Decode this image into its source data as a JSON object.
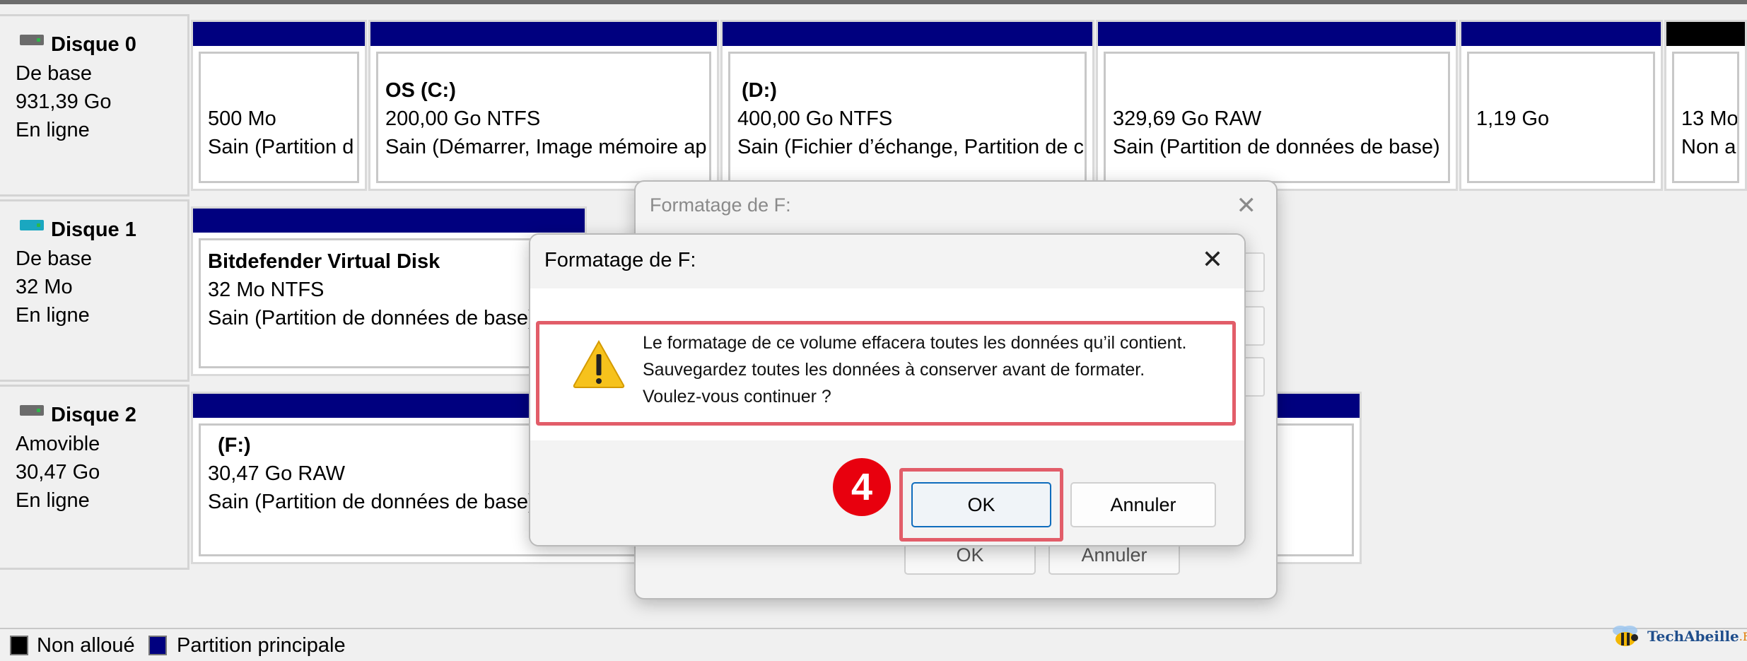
{
  "disks": [
    {
      "name": "Disque 0",
      "type": "De base",
      "size": "931,39 Go",
      "status": "En ligne",
      "icon": "hard-drive-icon",
      "partitions": [
        {
          "label": "",
          "size": "500 Mo",
          "status": "Sain (Partition d"
        },
        {
          "label": "OS  (C:)",
          "size": "200,00 Go NTFS",
          "status": "Sain (Démarrer, Image mémoire ap"
        },
        {
          "label": "(D:)",
          "size": "400,00 Go NTFS",
          "status": "Sain (Fichier d’échange, Partition de c"
        },
        {
          "label": "",
          "size": "329,69 Go RAW",
          "status": "Sain (Partition de données de base)"
        },
        {
          "label": "",
          "size": "1,19 Go",
          "status": ""
        },
        {
          "label": "",
          "size": "13 Mo",
          "status": "Non a"
        }
      ]
    },
    {
      "name": "Disque 1",
      "type": "De base",
      "size": "32 Mo",
      "status": "En ligne",
      "icon": "virtual-disk-icon",
      "partitions": [
        {
          "label": "Bitdefender Virtual Disk",
          "size": "32 Mo NTFS",
          "status": "Sain (Partition de données de base)"
        }
      ]
    },
    {
      "name": "Disque 2",
      "type": "Amovible",
      "size": "30,47 Go",
      "status": "En ligne",
      "icon": "removable-drive-icon",
      "partitions": [
        {
          "label": "(F:)",
          "size": "30,47 Go RAW",
          "status": "Sain (Partition de données de base)"
        }
      ]
    }
  ],
  "legend": {
    "unallocated": "Non alloué",
    "primary": "Partition principale"
  },
  "colors": {
    "primary": "#00007f",
    "unallocated": "#000000",
    "highlight": "#e25d69",
    "step": "#e8000e",
    "accent": "#0f6cbd"
  },
  "back_dialog": {
    "title": "Formatage de F:",
    "close": "✕",
    "ok": "OK",
    "cancel": "Annuler"
  },
  "dialog": {
    "title": "Formatage de F:",
    "close": "✕",
    "message": [
      "Le formatage de ce volume effacera toutes les données qu’il contient.",
      "Sauvegardez toutes les données à conserver avant de formater.",
      "Voulez-vous continuer ?"
    ],
    "icon": "warning-icon",
    "ok": "OK",
    "cancel": "Annuler"
  },
  "step_marker": "4",
  "brand": {
    "name": "TechAbeille",
    "suffix": ".FR",
    "icon": "bee-icon"
  }
}
